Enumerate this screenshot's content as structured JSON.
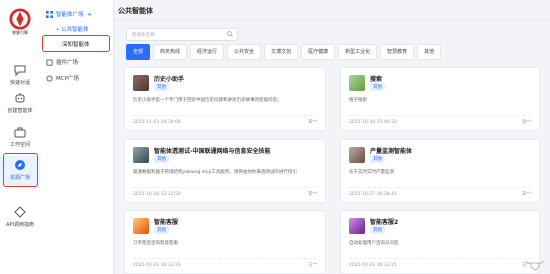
{
  "rail": {
    "logo_text": "睿睿引擎",
    "items": [
      {
        "label": "快速对话",
        "icon": "chat-icon"
      },
      {
        "label": "创建智能体",
        "icon": "robot-icon"
      },
      {
        "label": "工作空间",
        "icon": "briefcase-icon"
      },
      {
        "label": "资源广场",
        "icon": "compass-icon",
        "active": true
      },
      {
        "label": "API调用指南",
        "icon": "api-icon"
      }
    ]
  },
  "subnav": {
    "group": "智能体广场",
    "public": "• 公共智能体",
    "deep": "深知智能体",
    "plugin": "插件广场",
    "mcp": "MCP广场"
  },
  "main": {
    "title": "公共智能体",
    "search_placeholder": "智能体名称",
    "tabs": [
      "全部",
      "商务热线",
      "经济运行",
      "公共安全",
      "文博文创",
      "医疗健康",
      "新型工业化",
      "智慧教育",
      "其他"
    ],
    "cards": [
      {
        "name": "历史小助手",
        "badge": "其他",
        "desc": "历史小助手是一个专门用于回答中国历史问题和讲述历史故事的智能问答。",
        "date": "2025-11-03 14:34:09",
        "owner": "姜**"
      },
      {
        "name": "搜索",
        "badge": "其他",
        "desc": "搜于搜索",
        "date": "2025-10-30 15:46:22",
        "owner": "张**"
      },
      {
        "name": "智能体透测试-中国联通网络与信息安全技能",
        "badge": "其他",
        "desc": "联通数据利器于跨境结构yaklang mcp工具服务。请将由你你来透测试的进行指引",
        "date": "2025-10-28 12:12:50",
        "owner": "李**"
      },
      {
        "name": "产量监测智能体",
        "badge": "其他",
        "desc": "农于实时实时产量监测",
        "date": "2025-10-27 16:28:41",
        "owner": "宋**"
      },
      {
        "name": "智能客服",
        "badge": "其他",
        "desc": "订单售后咨询智能客服",
        "date": "2025-10-22 16:33:29",
        "owner": "王**"
      },
      {
        "name": "智能客服2",
        "badge": "其他",
        "desc": "自动处理用户咨询与问答",
        "date": "2025-10-22 16:33:25",
        "owner": "王**"
      }
    ]
  },
  "colors": {
    "accent": "#2b6cff",
    "highlight": "#e53935",
    "logo": "#d32f2f"
  }
}
